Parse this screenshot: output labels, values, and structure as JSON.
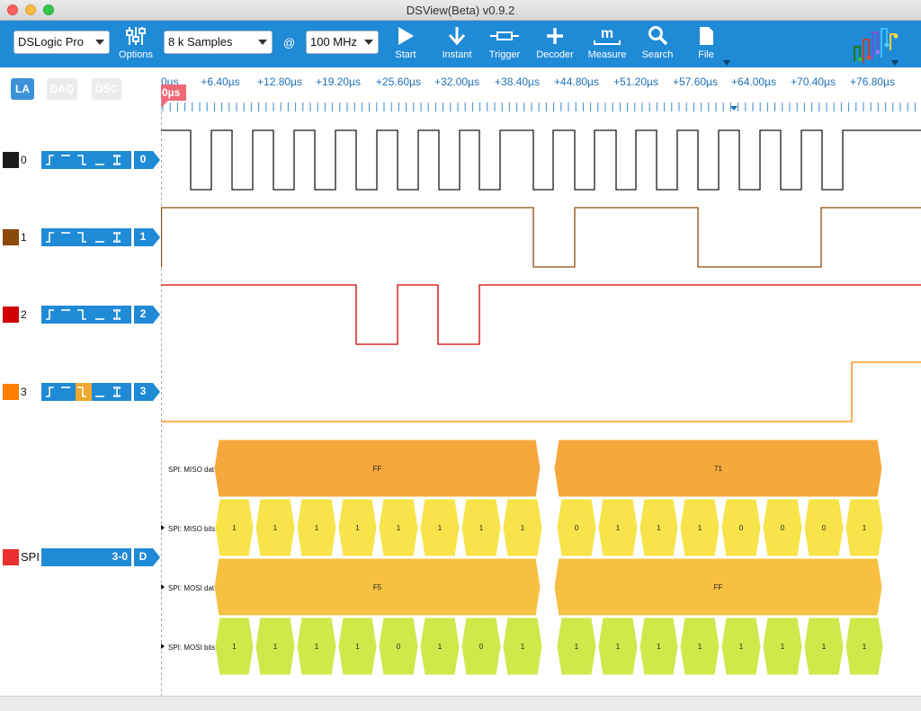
{
  "window": {
    "title": "DSView(Beta) v0.9.2"
  },
  "toolbar": {
    "device": "DSLogic Pro",
    "options_label": "Options",
    "samples": "8 k Samples",
    "at": "@",
    "rate": "100 MHz",
    "start_label": "Start",
    "instant_label": "Instant",
    "trigger_label": "Trigger",
    "decoder_label": "Decoder",
    "measure_label": "Measure",
    "search_label": "Search",
    "file_label": "File"
  },
  "modes": {
    "la": "LA",
    "daq": "DAQ",
    "osc": "OSC"
  },
  "ruler": {
    "cursor_label": "0µs",
    "ticks": [
      "0µs",
      "+6.40µs",
      "+12.80µs",
      "+19.20µs",
      "+25.60µs",
      "+32.00µs",
      "+38.40µs",
      "+44.80µs",
      "+51.20µs",
      "+57.60µs",
      "+64.00µs",
      "+70.40µs",
      "+76.80µs"
    ]
  },
  "channels": [
    {
      "name": "0",
      "tag": "0",
      "color": "#1a1a1a"
    },
    {
      "name": "1",
      "tag": "1",
      "color": "#8b4a0a"
    },
    {
      "name": "2",
      "tag": "2",
      "color": "#d00000"
    },
    {
      "name": "3",
      "tag": "3",
      "color": "#ff8000"
    }
  ],
  "decoder": {
    "name": "SPI",
    "range": "3-0",
    "tag": "D",
    "color": "#ec3030",
    "rows": [
      {
        "label": "SPI: MISO data",
        "values": [
          "FF",
          "71"
        ]
      },
      {
        "label": "SPI: MISO bits",
        "values": [
          "1",
          "1",
          "1",
          "1",
          "1",
          "1",
          "1",
          "1",
          "0",
          "1",
          "1",
          "1",
          "0",
          "0",
          "0",
          "1"
        ]
      },
      {
        "label": "SPI: MOSI data",
        "values": [
          "F5",
          "FF"
        ]
      },
      {
        "label": "SPI: MOSI bits",
        "values": [
          "1",
          "1",
          "1",
          "1",
          "0",
          "1",
          "0",
          "1",
          "1",
          "1",
          "1",
          "1",
          "1",
          "1",
          "1",
          "1"
        ]
      }
    ]
  }
}
